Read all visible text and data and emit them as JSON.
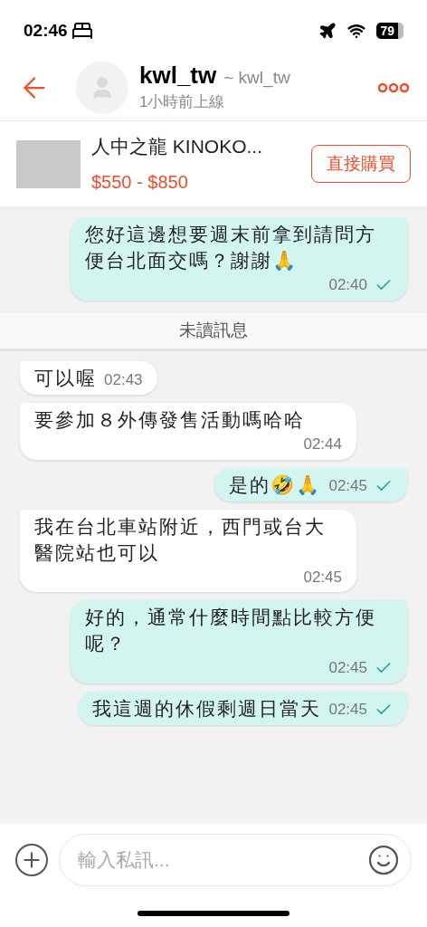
{
  "status_bar": {
    "time": "02:46",
    "battery": "79"
  },
  "header": {
    "name": "kwl_tw",
    "handle": "~ kwl_tw",
    "last_seen": "1小時前上線"
  },
  "product": {
    "title": "人中之龍 KINOKO...",
    "price": "$550 - $850",
    "buy_button": "直接購買"
  },
  "messages": [
    {
      "kind": "message",
      "outgoing": true,
      "text": "您好這邊想要週末前拿到請問方便台北面交嗎？謝謝🙏",
      "time": "02:40",
      "read": true
    },
    {
      "kind": "divider",
      "text": "未讀訊息"
    },
    {
      "kind": "message",
      "outgoing": false,
      "text": "可以喔",
      "time": "02:43",
      "read": false
    },
    {
      "kind": "message",
      "outgoing": false,
      "text": "要參加８外傳發售活動嗎哈哈",
      "time": "02:44",
      "read": false
    },
    {
      "kind": "message",
      "outgoing": true,
      "text": "是的🤣🙏",
      "time": "02:45",
      "read": true
    },
    {
      "kind": "message",
      "outgoing": false,
      "text": "我在台北車站附近，西門或台大醫院站也可以",
      "time": "02:45",
      "read": false
    },
    {
      "kind": "message",
      "outgoing": true,
      "text": "好的，通常什麼時間點比較方便呢？",
      "time": "02:45",
      "read": true
    },
    {
      "kind": "message",
      "outgoing": true,
      "text": "我這週的休假剩週日當天",
      "time": "02:45",
      "read": true
    }
  ],
  "composer": {
    "placeholder": "輸入私訊..."
  }
}
